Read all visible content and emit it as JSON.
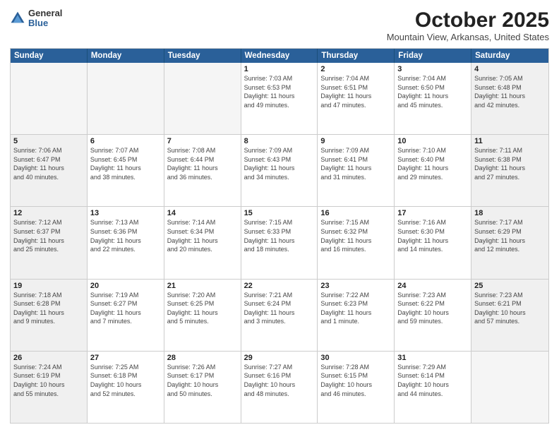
{
  "header": {
    "logo": {
      "general": "General",
      "blue": "Blue"
    },
    "title": "October 2025",
    "location": "Mountain View, Arkansas, United States"
  },
  "calendar": {
    "days_of_week": [
      "Sunday",
      "Monday",
      "Tuesday",
      "Wednesday",
      "Thursday",
      "Friday",
      "Saturday"
    ],
    "rows": [
      [
        {
          "day": "",
          "info": "",
          "empty": true
        },
        {
          "day": "",
          "info": "",
          "empty": true
        },
        {
          "day": "",
          "info": "",
          "empty": true
        },
        {
          "day": "1",
          "info": "Sunrise: 7:03 AM\nSunset: 6:53 PM\nDaylight: 11 hours\nand 49 minutes.",
          "empty": false
        },
        {
          "day": "2",
          "info": "Sunrise: 7:04 AM\nSunset: 6:51 PM\nDaylight: 11 hours\nand 47 minutes.",
          "empty": false
        },
        {
          "day": "3",
          "info": "Sunrise: 7:04 AM\nSunset: 6:50 PM\nDaylight: 11 hours\nand 45 minutes.",
          "empty": false
        },
        {
          "day": "4",
          "info": "Sunrise: 7:05 AM\nSunset: 6:48 PM\nDaylight: 11 hours\nand 42 minutes.",
          "empty": false,
          "gray": true
        }
      ],
      [
        {
          "day": "5",
          "info": "Sunrise: 7:06 AM\nSunset: 6:47 PM\nDaylight: 11 hours\nand 40 minutes.",
          "empty": false,
          "gray": true
        },
        {
          "day": "6",
          "info": "Sunrise: 7:07 AM\nSunset: 6:45 PM\nDaylight: 11 hours\nand 38 minutes.",
          "empty": false
        },
        {
          "day": "7",
          "info": "Sunrise: 7:08 AM\nSunset: 6:44 PM\nDaylight: 11 hours\nand 36 minutes.",
          "empty": false
        },
        {
          "day": "8",
          "info": "Sunrise: 7:09 AM\nSunset: 6:43 PM\nDaylight: 11 hours\nand 34 minutes.",
          "empty": false
        },
        {
          "day": "9",
          "info": "Sunrise: 7:09 AM\nSunset: 6:41 PM\nDaylight: 11 hours\nand 31 minutes.",
          "empty": false
        },
        {
          "day": "10",
          "info": "Sunrise: 7:10 AM\nSunset: 6:40 PM\nDaylight: 11 hours\nand 29 minutes.",
          "empty": false
        },
        {
          "day": "11",
          "info": "Sunrise: 7:11 AM\nSunset: 6:38 PM\nDaylight: 11 hours\nand 27 minutes.",
          "empty": false,
          "gray": true
        }
      ],
      [
        {
          "day": "12",
          "info": "Sunrise: 7:12 AM\nSunset: 6:37 PM\nDaylight: 11 hours\nand 25 minutes.",
          "empty": false,
          "gray": true
        },
        {
          "day": "13",
          "info": "Sunrise: 7:13 AM\nSunset: 6:36 PM\nDaylight: 11 hours\nand 22 minutes.",
          "empty": false
        },
        {
          "day": "14",
          "info": "Sunrise: 7:14 AM\nSunset: 6:34 PM\nDaylight: 11 hours\nand 20 minutes.",
          "empty": false
        },
        {
          "day": "15",
          "info": "Sunrise: 7:15 AM\nSunset: 6:33 PM\nDaylight: 11 hours\nand 18 minutes.",
          "empty": false
        },
        {
          "day": "16",
          "info": "Sunrise: 7:15 AM\nSunset: 6:32 PM\nDaylight: 11 hours\nand 16 minutes.",
          "empty": false
        },
        {
          "day": "17",
          "info": "Sunrise: 7:16 AM\nSunset: 6:30 PM\nDaylight: 11 hours\nand 14 minutes.",
          "empty": false
        },
        {
          "day": "18",
          "info": "Sunrise: 7:17 AM\nSunset: 6:29 PM\nDaylight: 11 hours\nand 12 minutes.",
          "empty": false,
          "gray": true
        }
      ],
      [
        {
          "day": "19",
          "info": "Sunrise: 7:18 AM\nSunset: 6:28 PM\nDaylight: 11 hours\nand 9 minutes.",
          "empty": false,
          "gray": true
        },
        {
          "day": "20",
          "info": "Sunrise: 7:19 AM\nSunset: 6:27 PM\nDaylight: 11 hours\nand 7 minutes.",
          "empty": false
        },
        {
          "day": "21",
          "info": "Sunrise: 7:20 AM\nSunset: 6:25 PM\nDaylight: 11 hours\nand 5 minutes.",
          "empty": false
        },
        {
          "day": "22",
          "info": "Sunrise: 7:21 AM\nSunset: 6:24 PM\nDaylight: 11 hours\nand 3 minutes.",
          "empty": false
        },
        {
          "day": "23",
          "info": "Sunrise: 7:22 AM\nSunset: 6:23 PM\nDaylight: 11 hours\nand 1 minute.",
          "empty": false
        },
        {
          "day": "24",
          "info": "Sunrise: 7:23 AM\nSunset: 6:22 PM\nDaylight: 10 hours\nand 59 minutes.",
          "empty": false
        },
        {
          "day": "25",
          "info": "Sunrise: 7:23 AM\nSunset: 6:21 PM\nDaylight: 10 hours\nand 57 minutes.",
          "empty": false,
          "gray": true
        }
      ],
      [
        {
          "day": "26",
          "info": "Sunrise: 7:24 AM\nSunset: 6:19 PM\nDaylight: 10 hours\nand 55 minutes.",
          "empty": false,
          "gray": true
        },
        {
          "day": "27",
          "info": "Sunrise: 7:25 AM\nSunset: 6:18 PM\nDaylight: 10 hours\nand 52 minutes.",
          "empty": false
        },
        {
          "day": "28",
          "info": "Sunrise: 7:26 AM\nSunset: 6:17 PM\nDaylight: 10 hours\nand 50 minutes.",
          "empty": false
        },
        {
          "day": "29",
          "info": "Sunrise: 7:27 AM\nSunset: 6:16 PM\nDaylight: 10 hours\nand 48 minutes.",
          "empty": false
        },
        {
          "day": "30",
          "info": "Sunrise: 7:28 AM\nSunset: 6:15 PM\nDaylight: 10 hours\nand 46 minutes.",
          "empty": false
        },
        {
          "day": "31",
          "info": "Sunrise: 7:29 AM\nSunset: 6:14 PM\nDaylight: 10 hours\nand 44 minutes.",
          "empty": false
        },
        {
          "day": "",
          "info": "",
          "empty": true,
          "gray": true
        }
      ]
    ]
  }
}
